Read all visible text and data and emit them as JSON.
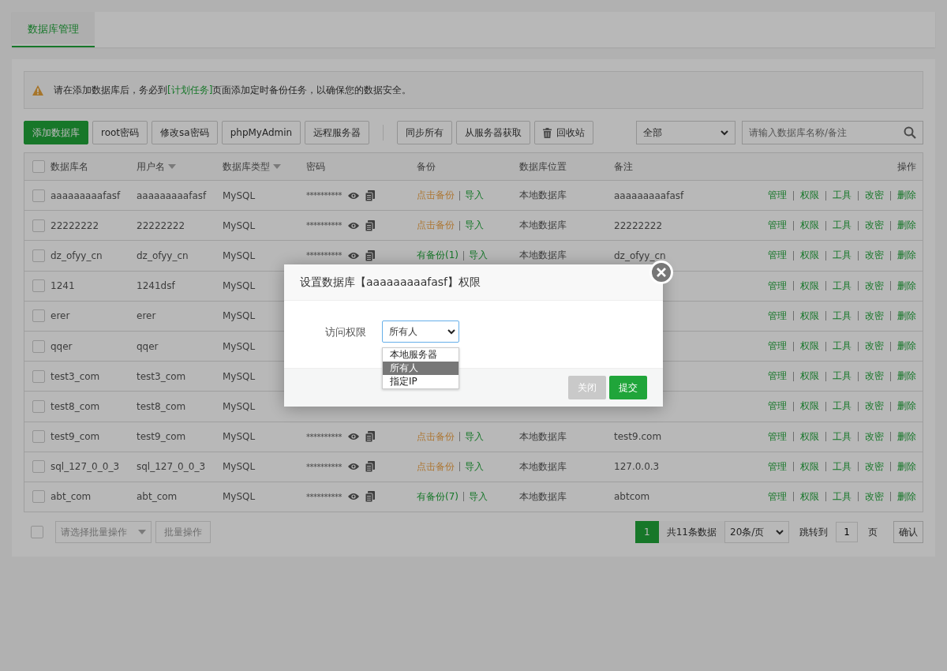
{
  "tabs": [
    {
      "label": "数据库管理",
      "selected": true
    }
  ],
  "notice": {
    "before": "请在添加数据库后，务必到",
    "link": "[计划任务]",
    "after": "页面添加定时备份任务，以确保您的数据安全。"
  },
  "toolbar": {
    "buttons": [
      {
        "label": "添加数据库",
        "kind": "primary"
      },
      {
        "label": "root密码",
        "kind": "default"
      },
      {
        "label": "修改sa密码",
        "kind": "default"
      },
      {
        "label": "phpMyAdmin",
        "kind": "default"
      },
      {
        "label": "远程服务器",
        "kind": "default"
      }
    ],
    "sync_buttons": [
      {
        "label": "同步所有",
        "kind": "default"
      },
      {
        "label": "从服务器获取",
        "kind": "default"
      },
      {
        "label": "回收站",
        "kind": "trash"
      }
    ],
    "filter": "全部",
    "search": {
      "placeholder": "请输入数据库名称/备注"
    }
  },
  "table": {
    "header_checked": false,
    "columns": [
      {
        "label": "数据库名",
        "sortable": false
      },
      {
        "label": "用户名",
        "sortable": true
      },
      {
        "label": "数据库类型",
        "sortable": true
      },
      {
        "label": "密码",
        "sortable": false
      },
      {
        "label": "备份",
        "sortable": false
      },
      {
        "label": "数据库位置",
        "sortable": false
      },
      {
        "label": "备注",
        "sortable": false
      },
      {
        "label": "操作",
        "sortable": false
      }
    ],
    "rows": [
      {
        "checked": false,
        "name": "aaaaaaaaafasf",
        "user": "aaaaaaaaafasf",
        "type": "MySQL",
        "password": "**********",
        "backup": {
          "text": "点击备份",
          "kind": "none"
        },
        "import": "导入",
        "location": "本地数据库",
        "note": "aaaaaaaaafasf",
        "actions": [
          "管理",
          "权限",
          "工具",
          "改密",
          "删除"
        ]
      },
      {
        "checked": false,
        "name": "22222222",
        "user": "22222222",
        "type": "MySQL",
        "password": "**********",
        "backup": {
          "text": "点击备份",
          "kind": "none"
        },
        "import": "导入",
        "location": "本地数据库",
        "note": "22222222",
        "actions": [
          "管理",
          "权限",
          "工具",
          "改密",
          "删除"
        ]
      },
      {
        "checked": false,
        "name": "dz_ofyy_cn",
        "user": "dz_ofyy_cn",
        "type": "MySQL",
        "password": "**********",
        "backup": {
          "text": "有备份(1)",
          "kind": "exists"
        },
        "import": "导入",
        "location": "本地数据库",
        "note": "dz_ofyy_cn",
        "actions": [
          "管理",
          "权限",
          "工具",
          "改密",
          "删除"
        ]
      },
      {
        "checked": false,
        "name": "1241",
        "user": "1241dsf",
        "type": "MySQL",
        "actions": [
          "管理",
          "权限",
          "工具",
          "改密",
          "删除"
        ]
      },
      {
        "checked": false,
        "name": "erer",
        "user": "erer",
        "type": "MySQL",
        "actions": [
          "管理",
          "权限",
          "工具",
          "改密",
          "删除"
        ]
      },
      {
        "checked": false,
        "name": "qqer",
        "user": "qqer",
        "type": "MySQL",
        "actions": [
          "管理",
          "权限",
          "工具",
          "改密",
          "删除"
        ]
      },
      {
        "checked": false,
        "name": "test3_com",
        "user": "test3_com",
        "type": "MySQL",
        "actions": [
          "管理",
          "权限",
          "工具",
          "改密",
          "删除"
        ]
      },
      {
        "checked": false,
        "name": "test8_com",
        "user": "test8_com",
        "type": "MySQL",
        "actions": [
          "管理",
          "权限",
          "工具",
          "改密",
          "删除"
        ]
      },
      {
        "checked": false,
        "name": "test9_com",
        "user": "test9_com",
        "type": "MySQL",
        "password": "**********",
        "backup": {
          "text": "点击备份",
          "kind": "none"
        },
        "import": "导入",
        "location": "本地数据库",
        "note": "test9.com",
        "actions": [
          "管理",
          "权限",
          "工具",
          "改密",
          "删除"
        ]
      },
      {
        "checked": false,
        "name": "sql_127_0_0_3",
        "user": "sql_127_0_0_3",
        "type": "MySQL",
        "password": "**********",
        "backup": {
          "text": "点击备份",
          "kind": "none"
        },
        "import": "导入",
        "location": "本地数据库",
        "note": "127.0.0.3",
        "actions": [
          "管理",
          "权限",
          "工具",
          "改密",
          "删除"
        ]
      },
      {
        "checked": false,
        "name": "abt_com",
        "user": "abt_com",
        "type": "MySQL",
        "password": "**********",
        "backup": {
          "text": "有备份(7)",
          "kind": "exists"
        },
        "import": "导入",
        "location": "本地数据库",
        "note": "abtcom",
        "actions": [
          "管理",
          "权限",
          "工具",
          "改密",
          "删除"
        ]
      }
    ]
  },
  "footer": {
    "checked": false,
    "batch_select": "请选择批量操作",
    "batch_button": "批量操作",
    "pages": [
      {
        "label": "1",
        "selected": true
      }
    ],
    "total": "共11条数据",
    "per_page": "20条/页",
    "jump_label": "跳转到",
    "jump_value": "1",
    "page_unit": "页",
    "confirm": "确认"
  },
  "dialog": {
    "title": "设置数据库【aaaaaaaaafasf】权限",
    "label": "访问权限",
    "value": "所有人",
    "options": [
      {
        "label": "本地服务器",
        "selected": false
      },
      {
        "label": "所有人",
        "selected": true
      },
      {
        "label": "指定IP",
        "selected": false
      }
    ],
    "buttons": [
      {
        "label": "关闭",
        "kind": "secondary"
      },
      {
        "label": "提交",
        "kind": "primary"
      }
    ]
  }
}
